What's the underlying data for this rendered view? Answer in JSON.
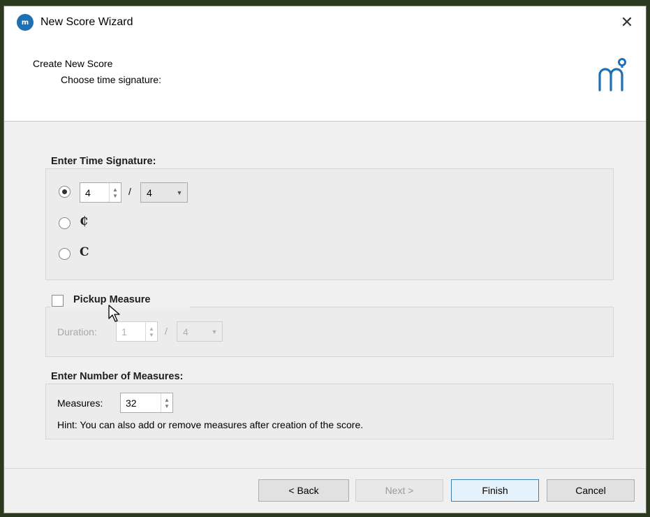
{
  "window": {
    "title": "New Score Wizard",
    "icon": "musescore-app-icon",
    "close_label": "✕"
  },
  "header": {
    "title": "Create New Score",
    "subtitle": "Choose time signature:",
    "logo_icon": "musescore-logo-icon",
    "logo_color": "#1f6fb5"
  },
  "time_signature": {
    "group_title": "Enter Time Signature:",
    "numerator": "4",
    "separator": "/",
    "denominator": "4",
    "cut_time_symbol": "₵",
    "common_time_symbol": "C",
    "selected_option": "custom"
  },
  "pickup": {
    "label": "Pickup Measure",
    "checked": false,
    "duration_label": "Duration:",
    "duration_numerator": "1",
    "separator": "/",
    "duration_denominator": "4"
  },
  "measures": {
    "group_title": "Enter Number of Measures:",
    "label": "Measures:",
    "value": "32",
    "hint": "Hint: You can also add or remove measures after creation of the score."
  },
  "buttons": {
    "back": "< Back",
    "next": "Next >",
    "finish": "Finish",
    "cancel": "Cancel"
  },
  "colors": {
    "accent": "#3c7fb1",
    "window_bg": "#f0f0f0"
  }
}
